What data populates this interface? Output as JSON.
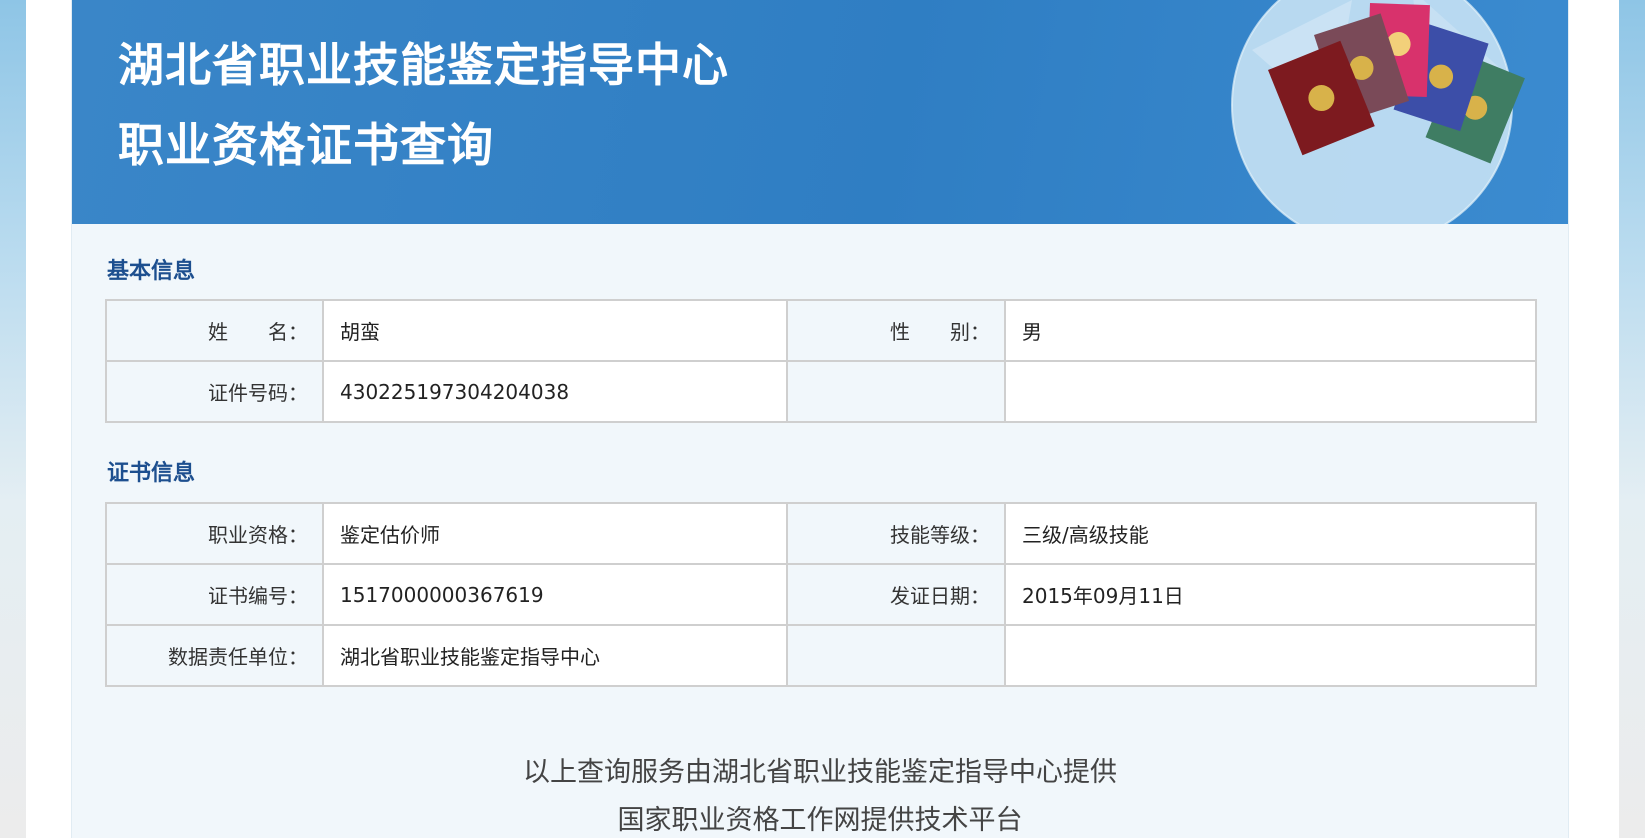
{
  "banner": {
    "title_line1": "湖北省职业技能鉴定指导中心",
    "title_line2": "职业资格证书查询"
  },
  "basic_info": {
    "heading": "基本信息",
    "name_label": "姓　　名：",
    "name_value": "胡蛮",
    "gender_label": "性　　别：",
    "gender_value": "男",
    "id_label": "证件号码：",
    "id_value": "430225197304204038"
  },
  "certificate_info": {
    "heading": "证书信息",
    "occupation_label": "职业资格：",
    "occupation_value": "鉴定估价师",
    "level_label": "技能等级：",
    "level_value": "三级/高级技能",
    "cert_no_label": "证书编号：",
    "cert_no_value": "1517000000367619",
    "issue_date_label": "发证日期：",
    "issue_date_value": "2015年09月11日",
    "data_unit_label": "数据责任单位：",
    "data_unit_value": "湖北省职业技能鉴定指导中心"
  },
  "footer": {
    "line1": "以上查询服务由湖北省职业技能鉴定指导中心提供",
    "line2": "国家职业资格工作网提供技术平台"
  },
  "colors": {
    "banner_blue": "#2f7ec3",
    "heading_blue": "#1d4f8f",
    "page_bg": "#f1f7fb"
  }
}
